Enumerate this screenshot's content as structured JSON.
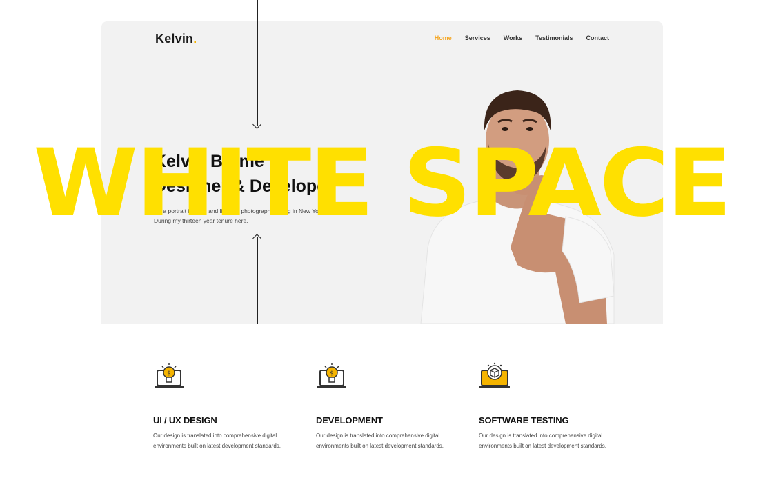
{
  "header": {
    "logo_text": "Kelvin",
    "logo_dot": ".",
    "nav": [
      {
        "label": "Home",
        "active": true
      },
      {
        "label": "Services",
        "active": false
      },
      {
        "label": "Works",
        "active": false
      },
      {
        "label": "Testimonials",
        "active": false
      },
      {
        "label": "Contact",
        "active": false
      }
    ]
  },
  "hero": {
    "title_line1": "Kelvin Brame",
    "title_line2": "Designer & Developer",
    "description_line1": "I'm a portrait fashion and lifestyle photographer living in New York City.",
    "description_line2": "During my thirteen year tenure here."
  },
  "overlay": {
    "text": "WHITE SPACE",
    "color": "#ffe000"
  },
  "services": [
    {
      "icon": "bulb-laptop-icon",
      "title": "UI / UX DESIGN",
      "description": "Our design is translated into comprehensive digital environments built on latest development standards."
    },
    {
      "icon": "bulb-laptop-icon",
      "title": "DEVELOPMENT",
      "description": "Our design is translated into comprehensive digital environments built on latest development standards."
    },
    {
      "icon": "cube-laptop-icon",
      "title": "SOFTWARE TESTING",
      "description": "Our design is translated into comprehensive digital environments built on latest development standards."
    }
  ],
  "colors": {
    "accent": "#f5a623",
    "hero_bg": "#f2f2f2"
  }
}
